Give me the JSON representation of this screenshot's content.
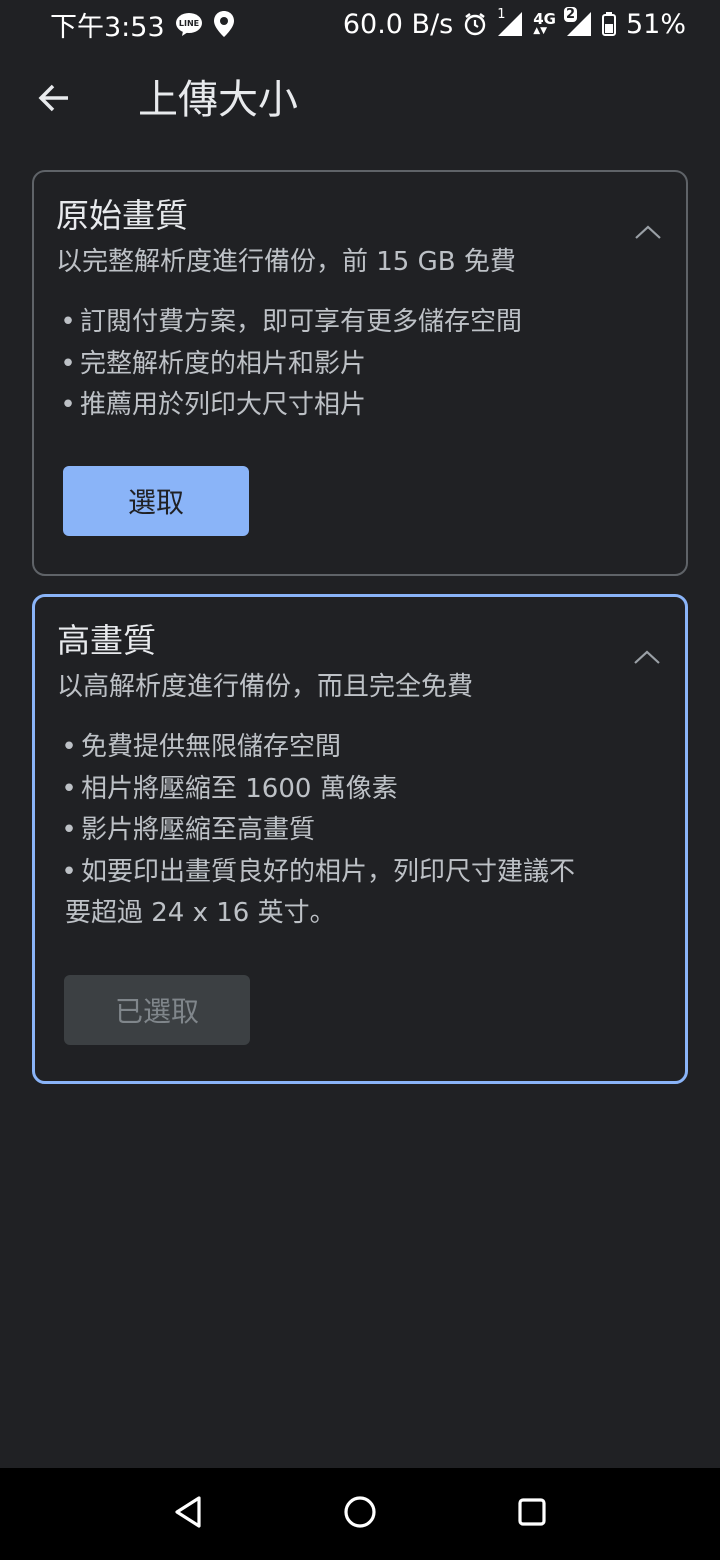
{
  "status_bar": {
    "time": "下午3:53",
    "net_speed": "60.0 B/s",
    "sim1_label": "1",
    "network_type": "4G",
    "sim2_label": "2",
    "battery": "51%",
    "icons": [
      "line-app-icon",
      "location-icon",
      "alarm-icon",
      "signal-icon",
      "signal-icon",
      "battery-icon"
    ]
  },
  "app_bar": {
    "title": "上傳大小",
    "back_icon": "arrow-back-icon"
  },
  "options": {
    "original": {
      "title": "原始畫質",
      "subtitle": "以完整解析度進行備份，前 15 GB 免費",
      "bullets": [
        "訂閱付費方案，即可享有更多儲存空間",
        "完整解析度的相片和影片",
        "推薦用於列印大尺寸相片"
      ],
      "button_label": "選取",
      "toggle_icon": "chevron-up-icon"
    },
    "high": {
      "title": "高畫質",
      "subtitle": "以高解析度進行備份，而且完全免費",
      "bullets": [
        "免費提供無限儲存空間",
        "相片將壓縮至 1600 萬像素",
        "影片將壓縮至高畫質",
        "如要印出畫質良好的相片，列印尺寸建議不"
      ],
      "bullet_continuation": "要超過 24 x 16 英寸。",
      "button_label": "已選取",
      "toggle_icon": "chevron-up-icon"
    }
  },
  "colors": {
    "background": "#202124",
    "accent": "#8ab4f8",
    "card_border": "#5f6368",
    "disabled_button": "#3c4043"
  },
  "nav_bar": {
    "icons": [
      "nav-back-icon",
      "nav-home-icon",
      "nav-recents-icon"
    ]
  }
}
